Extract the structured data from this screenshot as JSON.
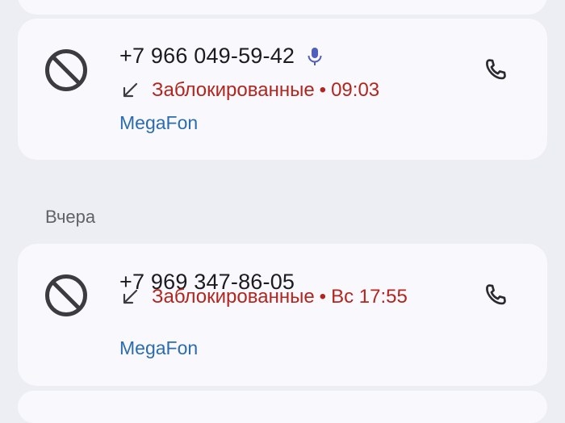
{
  "calls": [
    {
      "number": "+7 966 049-59-42",
      "status": "Заблокированные",
      "separator": "•",
      "time": "09:03",
      "carrier": "MegaFon",
      "has_voicemail": true
    },
    {
      "number": "+7 969 347-86-05",
      "status": "Заблокированные",
      "separator": "•",
      "time": "Вс 17:55",
      "carrier": "MegaFon",
      "has_voicemail": false
    }
  ],
  "sections": {
    "yesterday": "Вчера"
  },
  "icons": {
    "blocked": "block-icon",
    "incoming": "incoming-call-arrow-icon",
    "call": "phone-icon",
    "voicemail": "microphone-icon"
  },
  "colors": {
    "background": "#ededf4",
    "card": "#f8f8fd",
    "blocked_text": "#b3261e",
    "carrier_text": "#2b6cb0",
    "primary_text": "#1c1b1f",
    "mic_accent": "#4f5fbd"
  }
}
